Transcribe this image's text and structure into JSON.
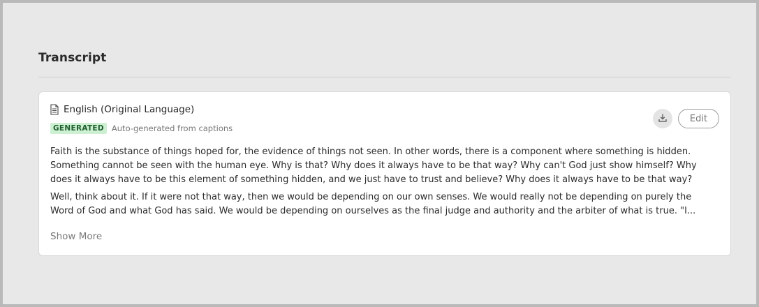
{
  "section": {
    "title": "Transcript"
  },
  "transcript_card": {
    "language_label": "English (Original Language)",
    "badge_label": "GENERATED",
    "source_note": "Auto-generated from captions",
    "edit_label": "Edit",
    "show_more_label": "Show More",
    "paragraphs": [
      "Faith is the substance of things hoped for, the evidence of things not seen. In other words, there is a component where something is hidden. Something cannot be seen with the human eye. Why is that? Why does it always have to be that way? Why can't God just show himself? Why does it always have to be this element of something hidden, and we just have to trust and believe? Why does it always have to be that way?",
      "Well, think about it. If it were not that way, then we would be depending on our own senses. We would really not be depending on purely the Word of God and what God has said. We would be depending on ourselves as the final judge and authority and the arbiter of what is true. \"I..."
    ]
  },
  "icons": {
    "language": "document-icon",
    "download": "download-icon"
  },
  "colors": {
    "badge_bg": "#cdf0d3",
    "badge_text": "#1f5f2e",
    "background": "#e8e8e8"
  }
}
